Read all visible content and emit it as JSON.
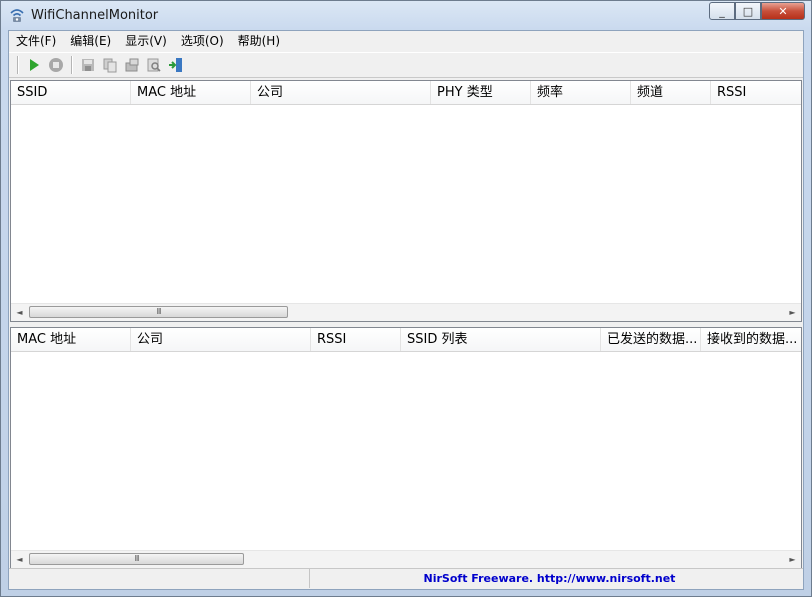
{
  "window": {
    "title": "WifiChannelMonitor"
  },
  "caption_buttons": {
    "min": "_",
    "max": "□",
    "close": "✕"
  },
  "menu": [
    "文件(F)",
    "编辑(E)",
    "显示(V)",
    "选项(O)",
    "帮助(H)"
  ],
  "toolbar": [
    "start-icon",
    "stop-icon",
    "save-icon",
    "copy-icon",
    "properties-icon",
    "find-icon",
    "exit-icon"
  ],
  "networks_table": {
    "columns": [
      "SSID",
      "MAC 地址",
      "公司",
      "PHY 类型",
      "频率",
      "频道",
      "RSSI"
    ],
    "rows": []
  },
  "clients_table": {
    "columns": [
      "MAC 地址",
      "公司",
      "RSSI",
      "SSID 列表",
      "已发送的数据...",
      "接收到的数据..."
    ],
    "rows": []
  },
  "scroll": {
    "left": "◄",
    "right": "►",
    "grip": "III"
  },
  "status": {
    "link": "NirSoft Freeware.  http://www.nirsoft.net"
  },
  "colors": {
    "play": "#2ea52e",
    "link": "#0000cc"
  }
}
